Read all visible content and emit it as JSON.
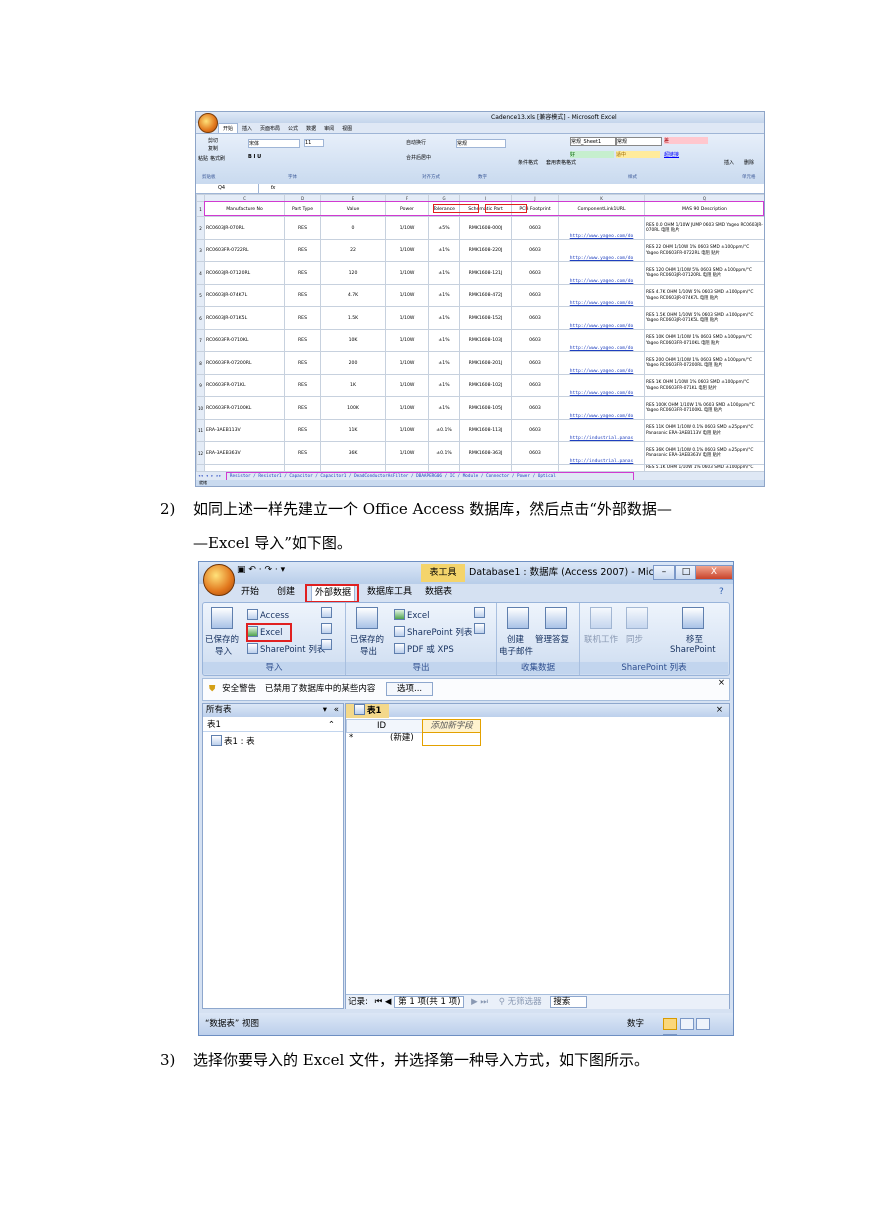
{
  "excel": {
    "window_title": "Cadence13.xls [兼容模式] - Microsoft Excel",
    "ribbon_tabs": [
      "开始",
      "插入",
      "页面布局",
      "公式",
      "数据",
      "审阅",
      "视图"
    ],
    "clipboard": [
      "剪切",
      "复制",
      "粘贴",
      "格式刷"
    ],
    "font_name": "宋体",
    "font_size": "11",
    "wrap_text": "自动换行",
    "merge_center": "合并后居中",
    "number_format": "常规",
    "cond_format": "条件格式",
    "table_format": "套用表格格式",
    "styles": [
      "常规_Sheet1",
      "常规",
      "差",
      "好",
      "适中",
      "超链接"
    ],
    "insert": "插入",
    "delete": "删除",
    "group_labels": [
      "剪贴板",
      "字体",
      "对齐方式",
      "数字",
      "样式",
      "单元格"
    ],
    "name_box": "Q4",
    "fx": "fx",
    "col_letters": [
      "C",
      "D",
      "E",
      "F",
      "G",
      "I",
      "J",
      "K",
      "Q"
    ],
    "headers": [
      "Manufacture No",
      "Part Type",
      "Value",
      "Power",
      "Tolerance",
      "Schematic Part",
      "PCB Footprint",
      "ComponentLink1URL",
      "MAS 90 Description"
    ],
    "rows": [
      {
        "n": "2",
        "c": [
          "RC0603JR-070RL",
          "RES",
          "0",
          "1/10W",
          "±5%",
          "RMK1608-000J",
          "0603",
          "http://www.yageo.com/do",
          "RES 0.0 OHM 1/10W JUMP 0603 SMD Yageo RC0603JR-070RL 电阻 贴片"
        ]
      },
      {
        "n": "3",
        "c": [
          "RC0603FR-0722RL",
          "RES",
          "22",
          "1/10W",
          "±1%",
          "RMK1608-220J",
          "0603",
          "http://www.yageo.com/do",
          "RES 22 OHM 1/10W 1% 0603 SMD ±100ppm/°C Yageo RC0603FR-0722RL 电阻 贴片"
        ]
      },
      {
        "n": "4",
        "c": [
          "RC0603JR-07120RL",
          "RES",
          "120",
          "1/10W",
          "±1%",
          "RMK1608-121J",
          "0603",
          "http://www.yageo.com/do",
          "RES 120 OHM 1/10W 5% 0603 SMD ±100ppm/°C Yageo RC0603JR-07120RL 电阻 贴片"
        ]
      },
      {
        "n": "5",
        "c": [
          "RC0603JR-074K7L",
          "RES",
          "4.7K",
          "1/10W",
          "±1%",
          "RMK1608-472J",
          "0603",
          "http://www.yageo.com/do",
          "RES 4.7K OHM 1/10W 5% 0603 SMD ±100ppm/°C Yageo RC0603JR-074K7L 电阻 贴片"
        ]
      },
      {
        "n": "6",
        "c": [
          "RC0603JR-071K5L",
          "RES",
          "1.5K",
          "1/10W",
          "±1%",
          "RMK1608-152J",
          "0603",
          "http://www.yageo.com/do",
          "RES 1.5K OHM 1/10W 5% 0603 SMD ±100ppm/°C Yageo RC0603JR-071K5L 电阻 贴片"
        ]
      },
      {
        "n": "7",
        "c": [
          "RC0603FR-0710KL",
          "RES",
          "10K",
          "1/10W",
          "±1%",
          "RMK1608-103J",
          "0603",
          "http://www.yageo.com/do",
          "RES 10K OHM 1/10W 1% 0603 SMD ±100ppm/°C Yageo RC0603FR-0710KL 电阻 贴片"
        ]
      },
      {
        "n": "8",
        "c": [
          "RC0603FR-07200RL",
          "RES",
          "200",
          "1/10W",
          "±1%",
          "RMK1608-201J",
          "0603",
          "http://www.yageo.com/do",
          "RES 200 OHM 1/10W 1% 0603 SMD ±100ppm/°C Yageo RC0603FR-07200RL 电阻 贴片"
        ]
      },
      {
        "n": "9",
        "c": [
          "RC0603FR-071KL",
          "RES",
          "1K",
          "1/10W",
          "±1%",
          "RMK1608-102J",
          "0603",
          "http://www.yageo.com/do",
          "RES 1K OHM 1/10W 1% 0603 SMD ±100ppm/°C Yageo RC0603FR-071KL 电阻 贴片"
        ]
      },
      {
        "n": "10",
        "c": [
          "RC0603FR-07100KL",
          "RES",
          "100K",
          "1/10W",
          "±1%",
          "RMK1608-105J",
          "0603",
          "http://www.yageo.com/do",
          "RES 100K OHM 1/10W 1% 0603 SMD ±100ppm/°C Yageo RC0603FR-07100KL 电阻 贴片"
        ]
      },
      {
        "n": "11",
        "c": [
          "ERA-3AEB113V",
          "RES",
          "11K",
          "1/10W",
          "±0.1%",
          "RMK1608-113J",
          "0603",
          "http://industrial.panas",
          "RES 11K OHM 1/10W 0.1% 0603 SMD ±25ppm/°C Panasonic ERA-3AEB113V 电阻 贴片"
        ]
      },
      {
        "n": "12",
        "c": [
          "ERA-3AEB363V",
          "RES",
          "36K",
          "1/10W",
          "±0.1%",
          "RMK1608-363J",
          "0603",
          "http://industrial.panas",
          "RES 36K OHM 1/10W 0.1% 0603 SMD ±25ppm/°C Panasonic ERA-3AEB363V 电阻 贴片"
        ]
      }
    ],
    "partial_desc": "RES 5.1K OHM 1/10W 1% 0603 SMD ±100ppm/°C",
    "sheet_tabs": "Resistor / Resistor1 / Capacitor / Capacitor1 / DeadConductorAsFilter / DBAAPERG06 / IC / Module / Connector / Power / Optical",
    "status": "就绪"
  },
  "paragraphs": {
    "p2_num": "2)",
    "p2_line1": "如同上述一样先建立一个 Office Access 数据库，然后点击“外部数据—",
    "p2_line2": "—Excel 导入”如下图。",
    "p3_num": "3)",
    "p3_line1": "选择你要导入的 Excel 文件，并选择第一种导入方式，如下图所示。"
  },
  "access": {
    "ctx_tab": "表工具",
    "title": "Database1 : 数据库 (Access 2007) - Microso...",
    "win_min": "–",
    "win_max": "□",
    "win_close": "X",
    "tabs": [
      "开始",
      "创建",
      "外部数据",
      "数据库工具",
      "数据表"
    ],
    "import_group": {
      "saved": "已保存的",
      "saved2": "导入",
      "access": "Access",
      "excel": "Excel",
      "sharepoint": "SharePoint 列表",
      "label": "导入"
    },
    "export_group": {
      "saved": "已保存的",
      "saved2": "导出",
      "excel": "Excel",
      "sharepoint": "SharePoint 列表",
      "pdf": "PDF 或 XPS",
      "label": "导出"
    },
    "collect_group": {
      "create": "创建",
      "create2": "电子邮件",
      "manage": "管理答复",
      "label": "收集数据"
    },
    "sp_group": {
      "offline": "联机工作",
      "sync": "同步",
      "move": "移至",
      "move2": "SharePoint",
      "label": "SharePoint 列表"
    },
    "security_label": "安全警告",
    "security_text": "已禁用了数据库中的某些内容",
    "options_button": "选项...",
    "nav_header": "所有表",
    "nav_group": "表1",
    "nav_item": "表1 : 表",
    "table_tab": "表1",
    "col_id": "ID",
    "col_add": "添加新字段",
    "new_row_marker": "*",
    "new_row_text": "(新建)",
    "record_label": "记录:",
    "record_pos": "第 1 项(共 1 项)",
    "filter_status": "无筛选器",
    "search": "搜索",
    "view_status": "“数据表” 视图",
    "num_status": "数字"
  }
}
